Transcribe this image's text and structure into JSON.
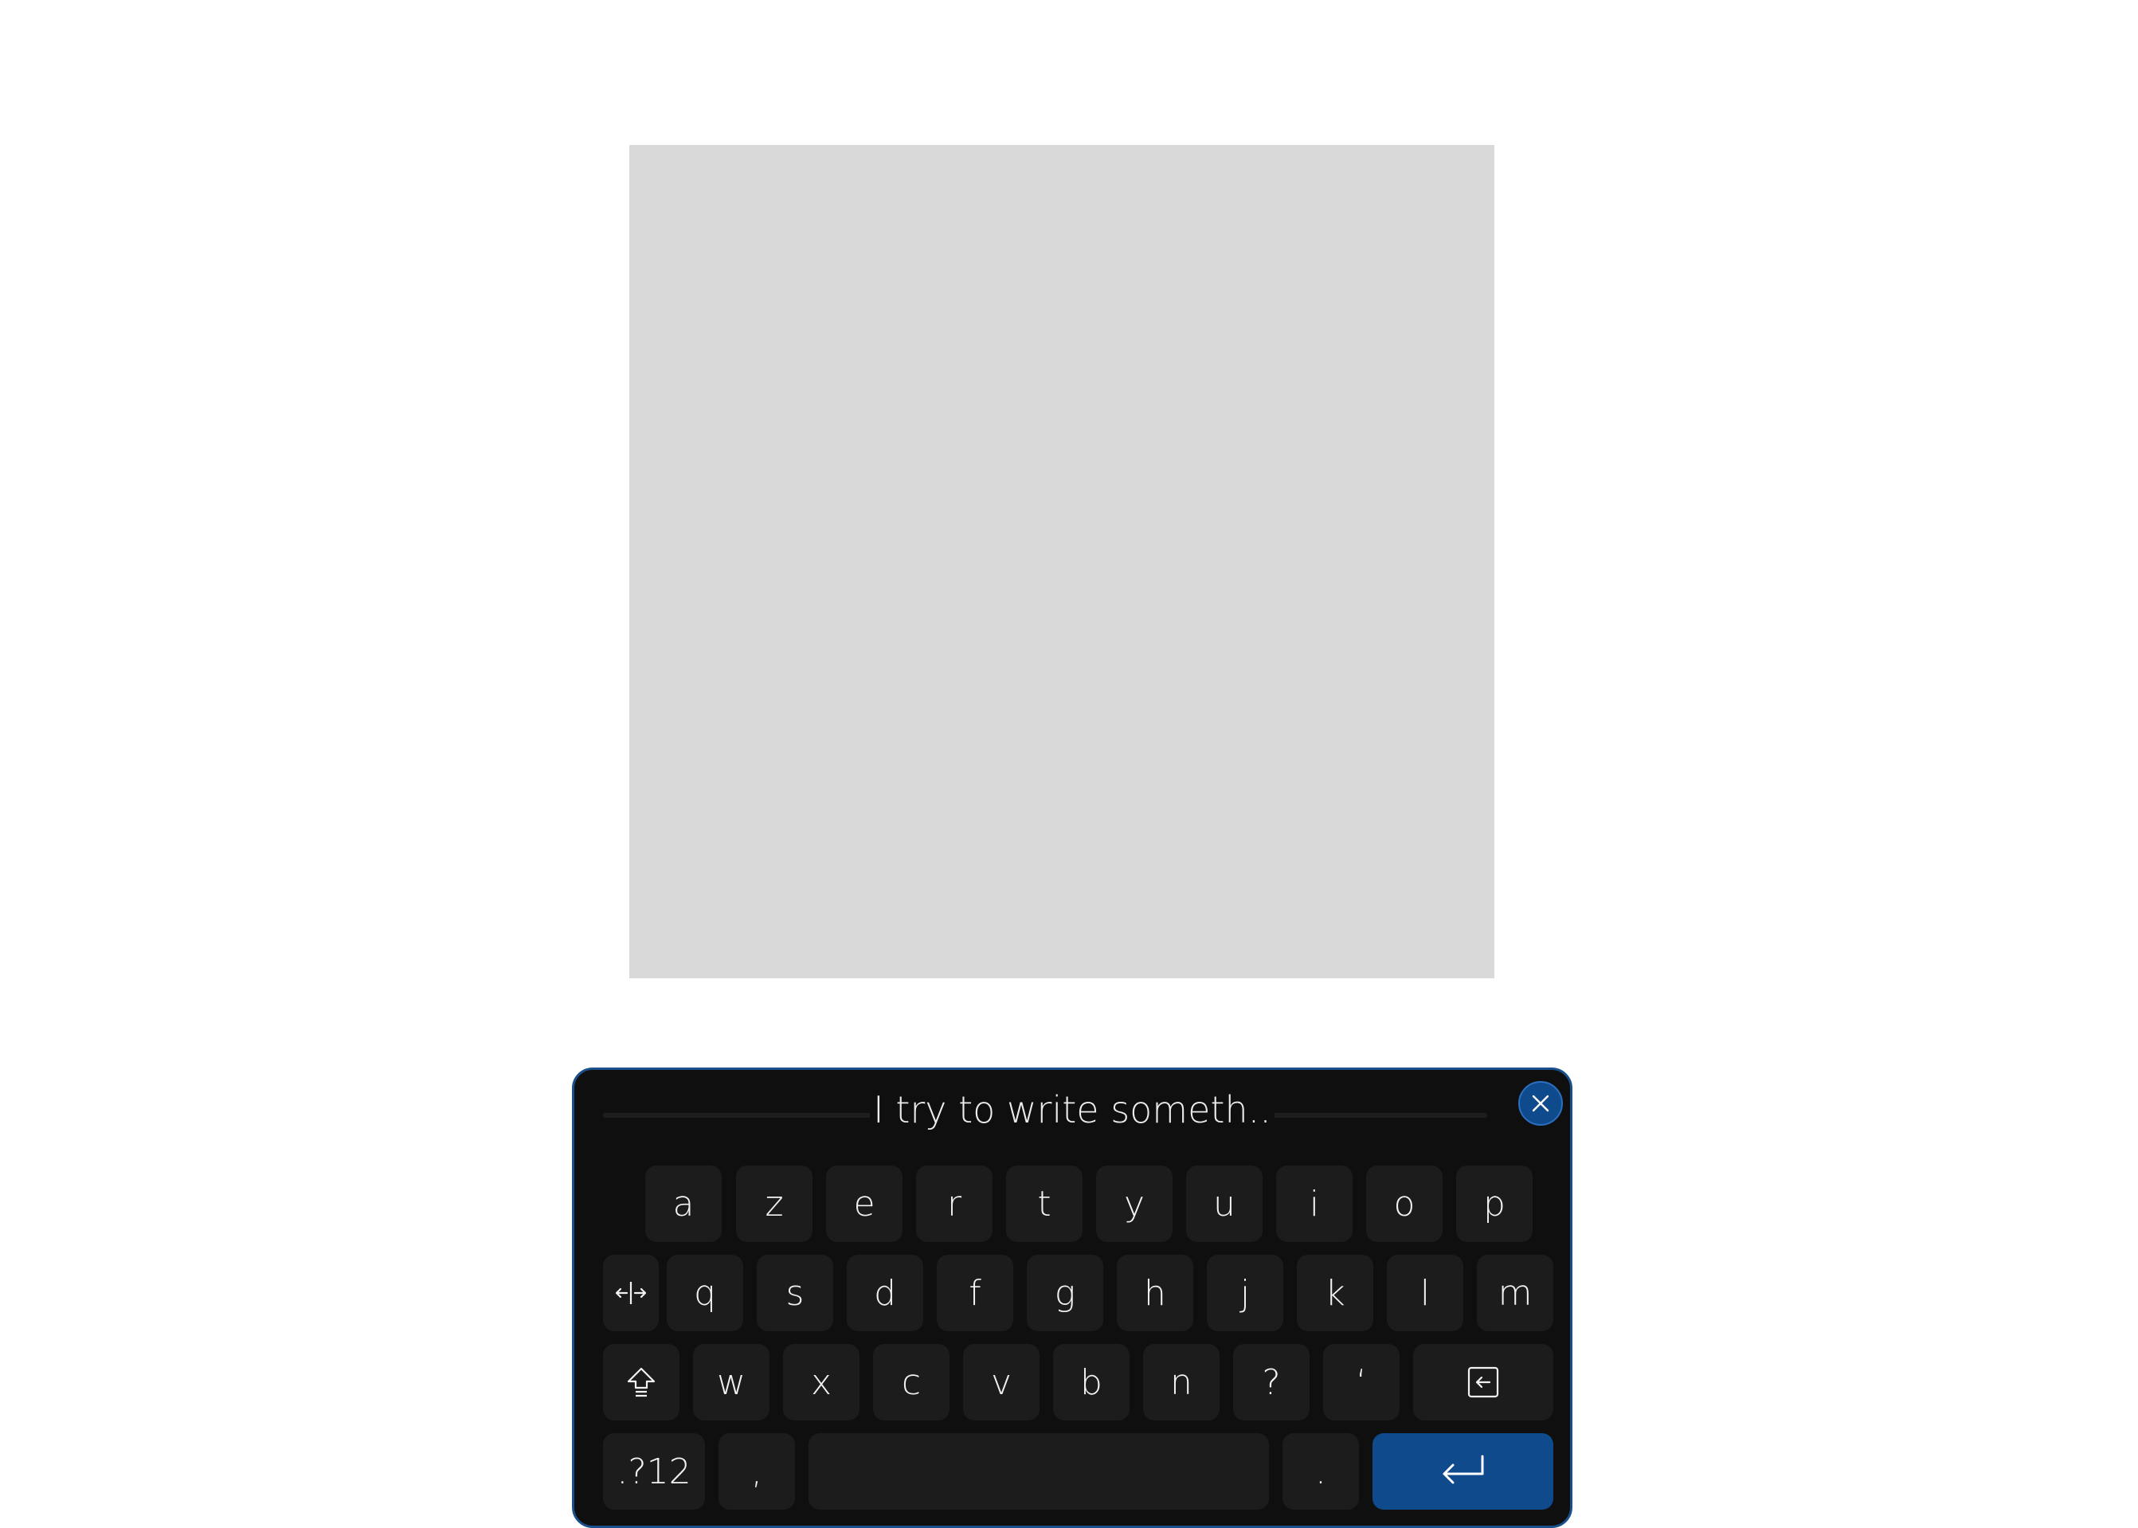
{
  "input": {
    "text": "I try to write someth.."
  },
  "keyboard": {
    "row1": [
      "a",
      "z",
      "e",
      "r",
      "t",
      "y",
      "u",
      "i",
      "o",
      "p"
    ],
    "row2": [
      "q",
      "s",
      "d",
      "f",
      "g",
      "h",
      "j",
      "k",
      "l",
      "m"
    ],
    "row3": [
      "w",
      "x",
      "c",
      "v",
      "b",
      "n",
      "?",
      "‘"
    ],
    "row4": {
      "symbols": ".?12",
      "comma": ",",
      "period": "."
    }
  },
  "icons": {
    "close": "close-icon",
    "cursor_move": "cursor-move-icon",
    "shift": "shift-icon",
    "backspace": "backspace-icon",
    "enter": "enter-icon"
  },
  "colors": {
    "keyboard_bg": "#0f0f0f",
    "key_bg": "#1c1c1c",
    "accent": "#0f4a8c",
    "placeholder": "#d9d9d9"
  }
}
